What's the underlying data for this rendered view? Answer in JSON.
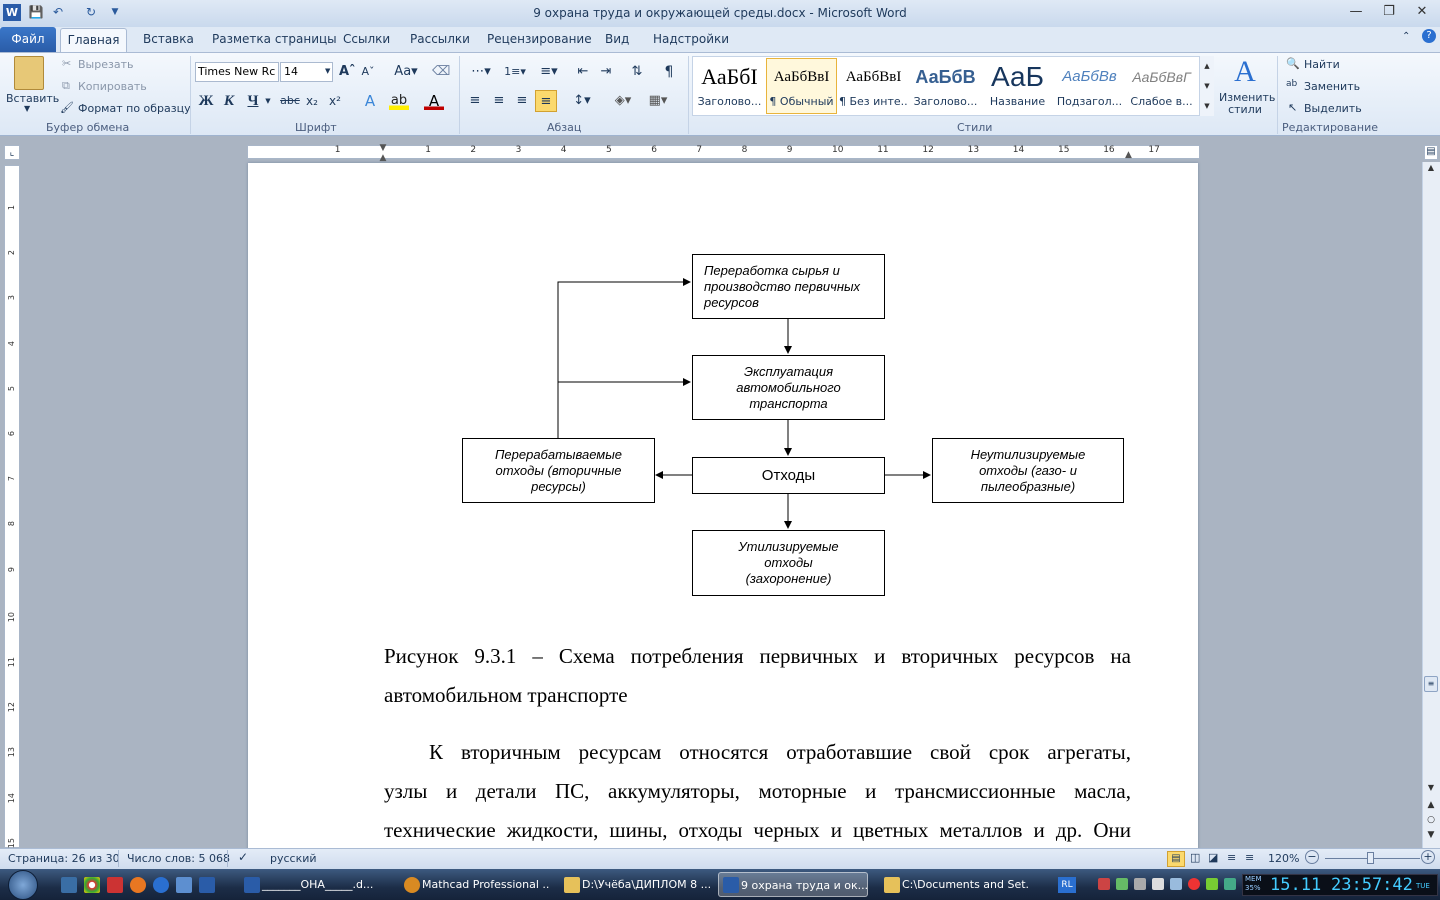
{
  "window": {
    "title": "9 охрана труда и окружающей среды.docx - Microsoft Word"
  },
  "tabs": {
    "file": "Файл",
    "items": [
      "Главная",
      "Вставка",
      "Разметка страницы",
      "Ссылки",
      "Рассылки",
      "Рецензирование",
      "Вид",
      "Надстройки"
    ]
  },
  "clipboard": {
    "paste": "Вставить",
    "cut": "Вырезать",
    "copy": "Копировать",
    "format_painter": "Формат по образцу",
    "title": "Буфер обмена"
  },
  "font": {
    "name": "Times New Rc",
    "size": "14",
    "title": "Шрифт",
    "bold": "Ж",
    "italic": "К",
    "underline": "Ч"
  },
  "paragraph": {
    "title": "Абзац"
  },
  "styles": {
    "title": "Стили",
    "items": [
      {
        "preview": "АаБбI",
        "name": "Заголово..."
      },
      {
        "preview": "АаБбВвI",
        "name": "¶ Обычный"
      },
      {
        "preview": "АаБбВвI",
        "name": "¶ Без инте..."
      },
      {
        "preview": "АаБбВ",
        "name": "Заголово..."
      },
      {
        "preview": "АаБ",
        "name": "Название"
      },
      {
        "preview": "АаБбВв",
        "name": "Подзагол..."
      },
      {
        "preview": "АаБбВвГ",
        "name": "Слабое в..."
      }
    ],
    "change": "Изменить стили"
  },
  "editing": {
    "title": "Редактирование",
    "find": "Найти",
    "replace": "Заменить",
    "select": "Выделить"
  },
  "ruler": {
    "h_marks": [
      "1",
      "1",
      "2",
      "3",
      "4",
      "5",
      "6",
      "7",
      "8",
      "9",
      "10",
      "11",
      "12",
      "13",
      "14",
      "15",
      "16",
      "17"
    ],
    "v_marks": [
      "1",
      "2",
      "3",
      "4",
      "5",
      "6",
      "7",
      "8",
      "9",
      "10",
      "11",
      "12",
      "13",
      "14",
      "15"
    ]
  },
  "diagram": {
    "box_raw": "Переработка сырья и производство первичных ресурсов",
    "box_exploit": "Эксплуатация автомобильного транспорта",
    "box_waste": "Отходы",
    "box_recycled": "Перерабатываемые отходы (вторичные ресурсы)",
    "box_nonutil": "Неутилизируемые отходы (газо- и пылеобразные)",
    "box_util": "Утилизируемые отходы (захоронение)"
  },
  "caption": {
    "line1": "Рисунок 9.3.1 – Схема потребления первичных и вторичных ресурсов на",
    "line2": "автомобильном транспорте"
  },
  "body": {
    "line1": "К вторичным ресурсам относятся отработавшие свой срок агрегаты,",
    "line2": "узлы и детали ПС, аккумуляторы, моторные и трансмиссионные масла,",
    "line3": "технические жидкости, шины, отходы черных и цветных металлов и др. Они"
  },
  "status": {
    "page": "Страница: 26 из 30",
    "words": "Число слов: 5 068",
    "lang": "русский",
    "zoom": "120%"
  },
  "taskbar": {
    "items": [
      "_______ОНА_____.d...",
      "Mathcad Professional ...",
      "D:\\Учёба\\ДИПЛОМ 8 ...",
      "9 охрана труда и ок...",
      "C:\\Documents and Set..."
    ],
    "lang": "RL",
    "clock_date": "15.11",
    "clock_time": "23:57:42",
    "clock_day": "TUE",
    "mem": "MEM",
    "mem_val": "35%"
  }
}
